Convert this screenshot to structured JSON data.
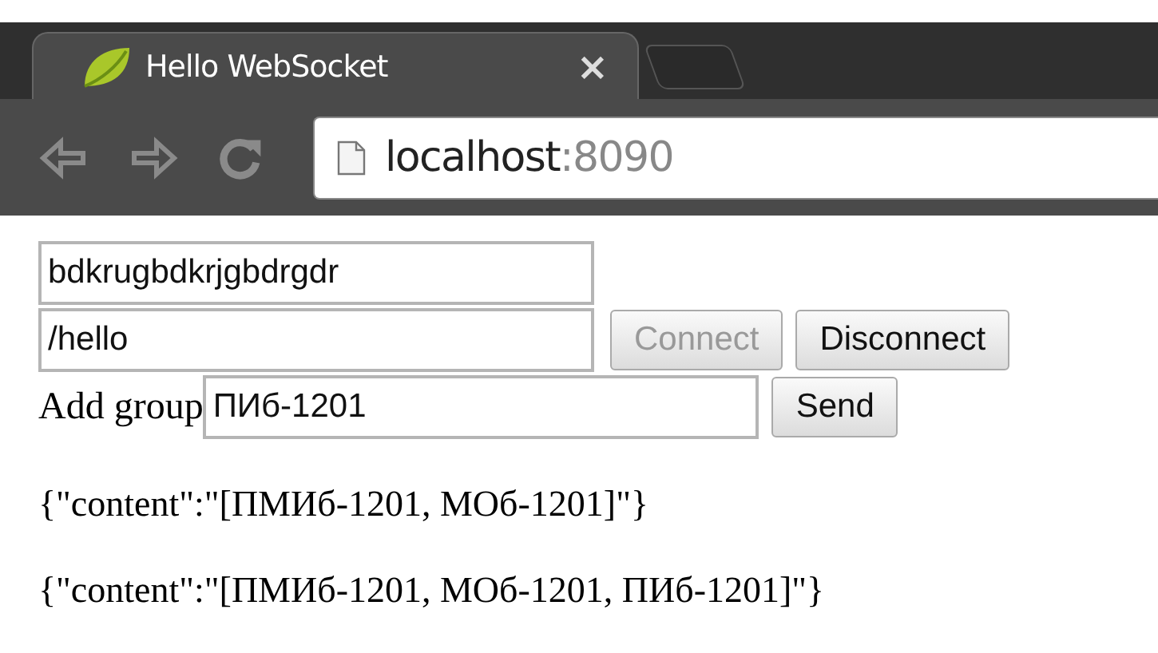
{
  "browser": {
    "tab": {
      "title": "Hello WebSocket",
      "close": "×"
    },
    "address": {
      "host": "localhost",
      "port": ":8090"
    }
  },
  "form": {
    "name_field": {
      "value": "bdkrugbdkrjgbdrgdr"
    },
    "endpoint_field": {
      "value": "/hello"
    },
    "connect_buttons": [
      {
        "label": "Connect",
        "disabled": true
      },
      {
        "label": "Disconnect",
        "disabled": false
      }
    ],
    "group_label": "Add group",
    "group_field": {
      "value": "ПИб-1201"
    },
    "send_button": {
      "label": "Send",
      "disabled": false
    }
  },
  "messages": [
    "{\"content\":\"[ПМИб-1201, МОб-1201]\"}",
    "{\"content\":\"[ПМИб-1201, МОб-1201, ПИб-1201]\"}"
  ]
}
